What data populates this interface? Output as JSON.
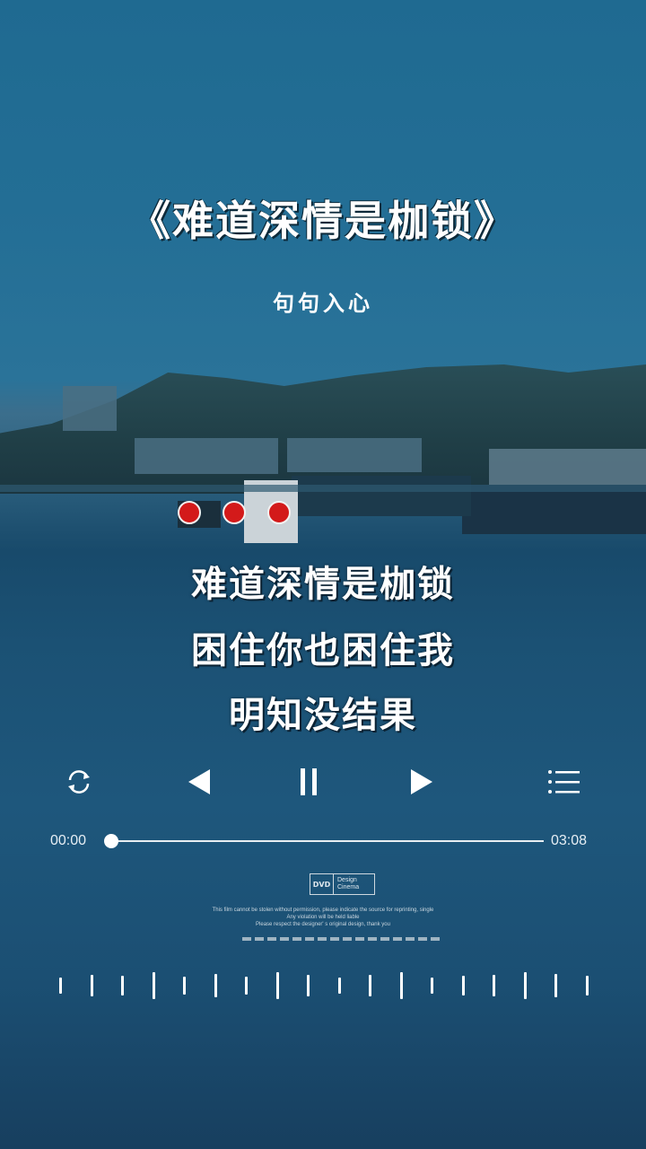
{
  "song": {
    "title": "《难道深情是枷锁》",
    "subtitle": "句句入心"
  },
  "lyrics": [
    "难道深情是枷锁",
    "困住你也困住我",
    "明知没结果"
  ],
  "controls": {
    "repeat": "repeat-icon",
    "previous": "previous-icon",
    "pause": "pause-icon",
    "next": "next-icon",
    "playlist": "playlist-icon"
  },
  "player": {
    "elapsed": "00:00",
    "duration": "03:08",
    "progress": 0
  },
  "watermark": {
    "logo_box": "DVD",
    "logo_line1": "Design",
    "logo_line2": "Cinema",
    "notice_1": "This film cannot be stolen without permission, please indicate the source for reprinting, single",
    "notice_2": "Any violation will be held liable",
    "notice_3": "Please respect the designer' s original design, thank you"
  },
  "colors": {
    "background": "#236e95",
    "light_red": "#d31a1a",
    "text": "#ffffff"
  },
  "visualizer": {
    "levels": [
      0.45,
      0.6,
      0.55,
      0.75,
      0.5,
      0.65,
      0.5,
      0.75,
      0.6,
      0.45,
      0.6,
      0.75,
      0.45,
      0.55,
      0.6,
      0.75,
      0.65,
      0.55
    ]
  }
}
